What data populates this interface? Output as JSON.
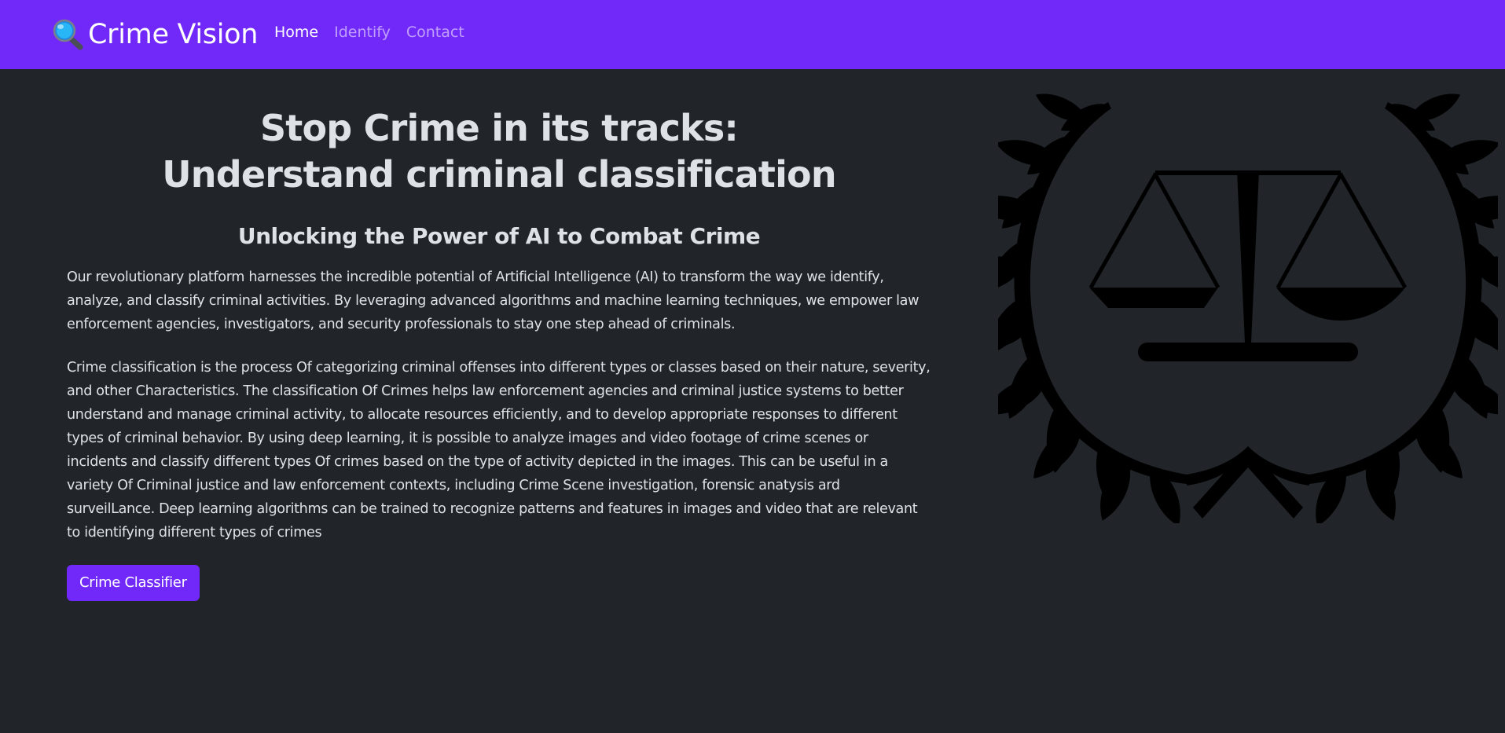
{
  "navbar": {
    "brand": "Crime Vision",
    "brand_icon": "magnifying-glass-icon",
    "links": [
      {
        "label": "Home",
        "active": true
      },
      {
        "label": "Identify",
        "active": false
      },
      {
        "label": "Contact",
        "active": false
      }
    ]
  },
  "hero": {
    "title_line1": "Stop Crime in its tracks:",
    "title_line2": "Understand criminal classification",
    "subtitle": "Unlocking the Power of AI to Combat Crime",
    "paragraph1": "Our revolutionary platform harnesses the incredible potential of Artificial Intelligence (AI) to transform the way we identify, analyze, and classify criminal activities. By leveraging advanced algorithms and machine learning techniques, we empower law enforcement agencies, investigators, and security professionals to stay one step ahead of criminals.",
    "paragraph2": "Crime classification is the process Of categorizing criminal offenses into different types or classes based on their nature, severity, and other Characteristics. The classification Of Crimes helps law enforcement agencies and criminal justice systems to better understand and manage criminal activity, to allocate resources efficiently, and to develop appropriate responses to different types of criminal behavior. By using deep learning, it is possible to analyze images and video footage of crime scenes or incidents and classify different types Of crimes based on the type of activity depicted in the images. This can be useful in a variety Of Criminal justice and law enforcement contexts, including Crime Scene investigation, forensic anatysis ard surveilLance. Deep learning algorithms can be trained to recognize patterns and features in images and video that are relevant to identifying different types of crimes",
    "cta_label": "Crime Classifier"
  },
  "emblem": {
    "icon": "scales-of-justice-laurel-icon"
  },
  "colors": {
    "navbar": "#7129f9",
    "background": "#212529",
    "text": "#dee2e6",
    "button": "#7129f9",
    "emblem": "#000000"
  }
}
